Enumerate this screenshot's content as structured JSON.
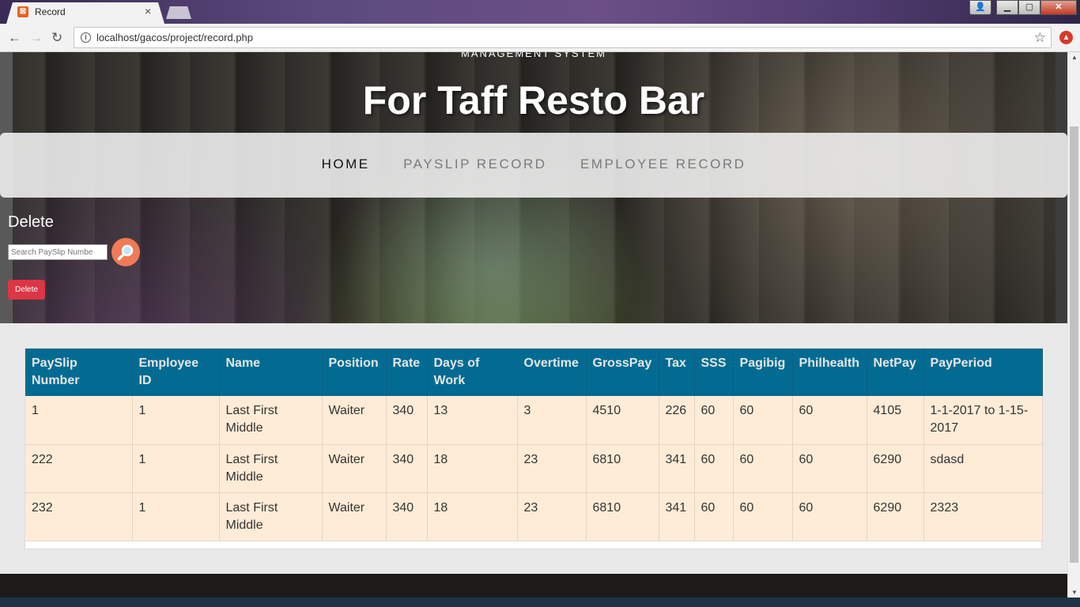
{
  "browser": {
    "tab_title": "Record",
    "tab_close": "×",
    "url": "localhost/gacos/project/record.php",
    "back": "←",
    "forward": "→",
    "reload": "↻",
    "star": "☆"
  },
  "header": {
    "subtitle": "MANAGEMENT SYSTEM",
    "title": "For Taff Resto Bar"
  },
  "nav": {
    "items": [
      {
        "label": "HOME",
        "active": true
      },
      {
        "label": "PAYSLIP RECORD",
        "active": false
      },
      {
        "label": "EMPLOYEE RECORD",
        "active": false
      }
    ]
  },
  "delete_section": {
    "title": "Delete",
    "search_placeholder": "Search PaySlip Numbe",
    "delete_label": "Delete"
  },
  "table": {
    "headers": [
      "PaySlip Number",
      "Employee ID",
      "Name",
      "Position",
      "Rate",
      "Days of Work",
      "Overtime",
      "GrossPay",
      "Tax",
      "SSS",
      "Pagibig",
      "Philhealth",
      "NetPay",
      "PayPeriod"
    ],
    "rows": [
      [
        "1",
        "1",
        "Last First Middle",
        "Waiter",
        "340",
        "13",
        "3",
        "4510",
        "226",
        "60",
        "60",
        "60",
        "4105",
        "1-1-2017 to 1-15-2017"
      ],
      [
        "222",
        "1",
        "Last First Middle",
        "Waiter",
        "340",
        "18",
        "23",
        "6810",
        "341",
        "60",
        "60",
        "60",
        "6290",
        "sdasd"
      ],
      [
        "232",
        "1",
        "Last First Middle",
        "Waiter",
        "340",
        "18",
        "23",
        "6810",
        "341",
        "60",
        "60",
        "60",
        "6290",
        "2323"
      ]
    ]
  },
  "colors": {
    "table_header_bg": "#036b92",
    "table_row_bg": "#feecd7",
    "delete_button": "#dc3545",
    "search_button": "#f07a55"
  }
}
